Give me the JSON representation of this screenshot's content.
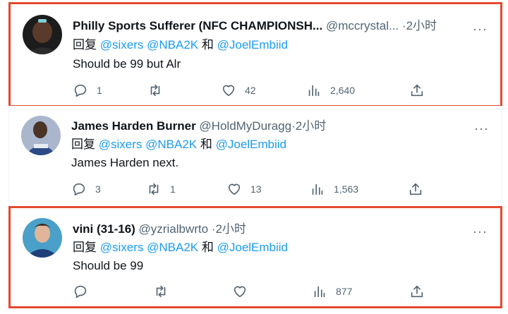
{
  "common": {
    "reply_prefix": "回复",
    "and": "和",
    "dot": "·",
    "more": "···"
  },
  "tweets": [
    {
      "name": "Philly Sports Sufferer (NFC CHAMPIONSH...",
      "handle": "@mccrystal...",
      "time": "2小时",
      "mentions": [
        "@sixers",
        "@NBA2K",
        "@JoelEmbiid"
      ],
      "text": "Should be 99 but Alr",
      "replies": "1",
      "retweets": "",
      "likes": "42",
      "views": "2,640",
      "avatar_color": "#2a2a2a",
      "highlighted": true
    },
    {
      "name": "James Harden Burner",
      "handle": "@HoldMyDuragg",
      "time": "2小时",
      "mentions": [
        "@sixers",
        "@NBA2K",
        "@JoelEmbiid"
      ],
      "text": "James Harden next.",
      "replies": "3",
      "retweets": "1",
      "likes": "13",
      "views": "1,563",
      "avatar_color": "#3b4a66",
      "highlighted": false
    },
    {
      "name": "vini (31-16)",
      "handle": "@yzrialbwrto",
      "time": "2小时",
      "mentions": [
        "@sixers",
        "@NBA2K",
        "@JoelEmbiid"
      ],
      "text": "Should be 99",
      "replies": "",
      "retweets": "",
      "likes": "",
      "views": "877",
      "avatar_color": "#2f5fa8",
      "highlighted": true
    }
  ],
  "colors": {
    "link": "#1d9bf0",
    "highlight_border": "#e5492f",
    "muted": "#536471"
  },
  "icons": [
    "reply-icon",
    "retweet-icon",
    "like-icon",
    "views-icon",
    "share-icon",
    "more-icon"
  ]
}
